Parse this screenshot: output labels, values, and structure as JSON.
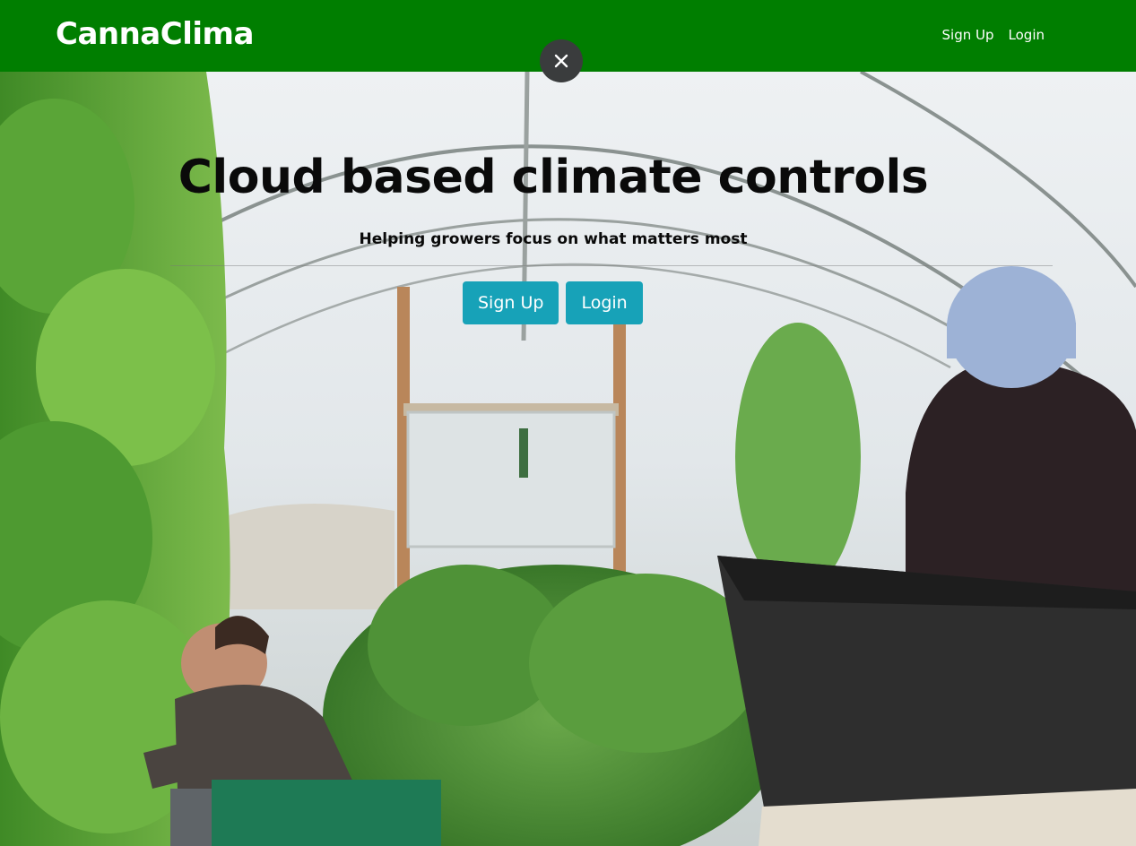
{
  "navbar": {
    "brand": "CannaClima",
    "links": [
      "Sign Up",
      "Login"
    ],
    "color": "#007e00"
  },
  "overlay": {
    "close_icon": "close-icon"
  },
  "hero": {
    "title": "Cloud based climate controls",
    "subtitle": "Helping growers focus on what matters most",
    "buttons": [
      "Sign Up",
      "Login"
    ],
    "button_color": "#17a2b8",
    "background": "greenhouse-photo"
  }
}
